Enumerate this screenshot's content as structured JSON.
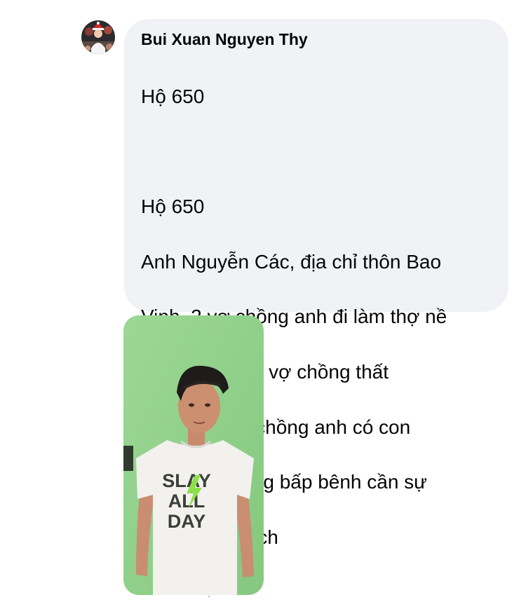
{
  "comment": {
    "author": "Bui Xuan Nguyen Thy",
    "lines": [
      "Hộ 650",
      "",
      "Hộ 650",
      "Anh Nguyễn Các, địa chỉ thôn Bao",
      "Vinh, 2 vợ chồng anh đi làm thợ nề",
      "mùa dịch cả 2 vợ chồng thất",
      "nghiệp, 2 vợ chồng anh có con",
      "nhỏ, cuộc sống bấp bênh cần sự",
      "hỗ trợ mùa dịch"
    ],
    "avatar_icon": "profile-photo-avatar",
    "bubble_color": "#f0f2f5"
  },
  "attachment": {
    "type": "photo",
    "shirt_print": [
      "SLAY",
      "ALL",
      "DAY"
    ],
    "background_color": "#8fd08a"
  }
}
